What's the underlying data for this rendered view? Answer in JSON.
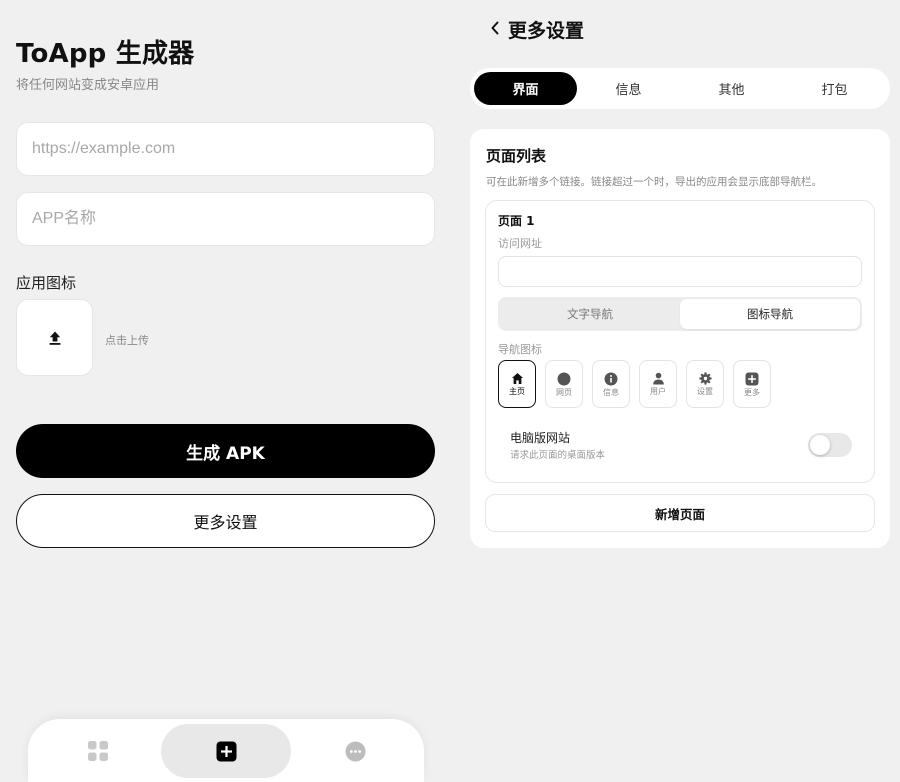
{
  "generator": {
    "title": "ToApp 生成器",
    "subtitle": "将任何网站变成安卓应用",
    "url_placeholder": "https://example.com",
    "name_placeholder": "APP名称",
    "icon_label": "应用图标",
    "upload_hint": "点击上传",
    "generate_label": "生成 APK",
    "more_settings_label": "更多设置",
    "upload_icon": "upload-arrow-icon"
  },
  "bottom_nav": {
    "items": [
      {
        "id": "apps",
        "icon": "grid-icon"
      },
      {
        "id": "create",
        "icon": "plus-square-icon",
        "active": true
      },
      {
        "id": "more",
        "icon": "ellipsis-circle-icon"
      }
    ]
  },
  "settings": {
    "title": "更多设置",
    "tabs": [
      {
        "label": "界面",
        "active": true
      },
      {
        "label": "信息"
      },
      {
        "label": "其他"
      },
      {
        "label": "打包"
      }
    ],
    "section": {
      "title": "页面列表",
      "description": "可在此新增多个链接。链接超过一个时，导出的应用会显示底部导航栏。",
      "page": {
        "name": "页面 1",
        "url_label": "访问网址",
        "url_value": "",
        "nav_options": {
          "text": "文字导航",
          "icon": "图标导航",
          "selected": "icon"
        },
        "nav_icon_label": "导航图标",
        "nav_icons": [
          {
            "label": "主页",
            "icon": "home-icon",
            "selected": true
          },
          {
            "label": "网页",
            "icon": "globe-icon"
          },
          {
            "label": "信息",
            "icon": "info-icon"
          },
          {
            "label": "用户",
            "icon": "user-icon"
          },
          {
            "label": "设置",
            "icon": "gear-icon"
          },
          {
            "label": "更多",
            "icon": "plus-square-icon"
          }
        ],
        "desktop": {
          "title": "电脑版网站",
          "description": "请求此页面的桌面版本",
          "enabled": false
        }
      },
      "add_page_label": "新增页面"
    }
  },
  "colors": {
    "accent": "#000000",
    "background": "#f0f0f0",
    "surface": "#ffffff",
    "muted_text": "#888888"
  }
}
